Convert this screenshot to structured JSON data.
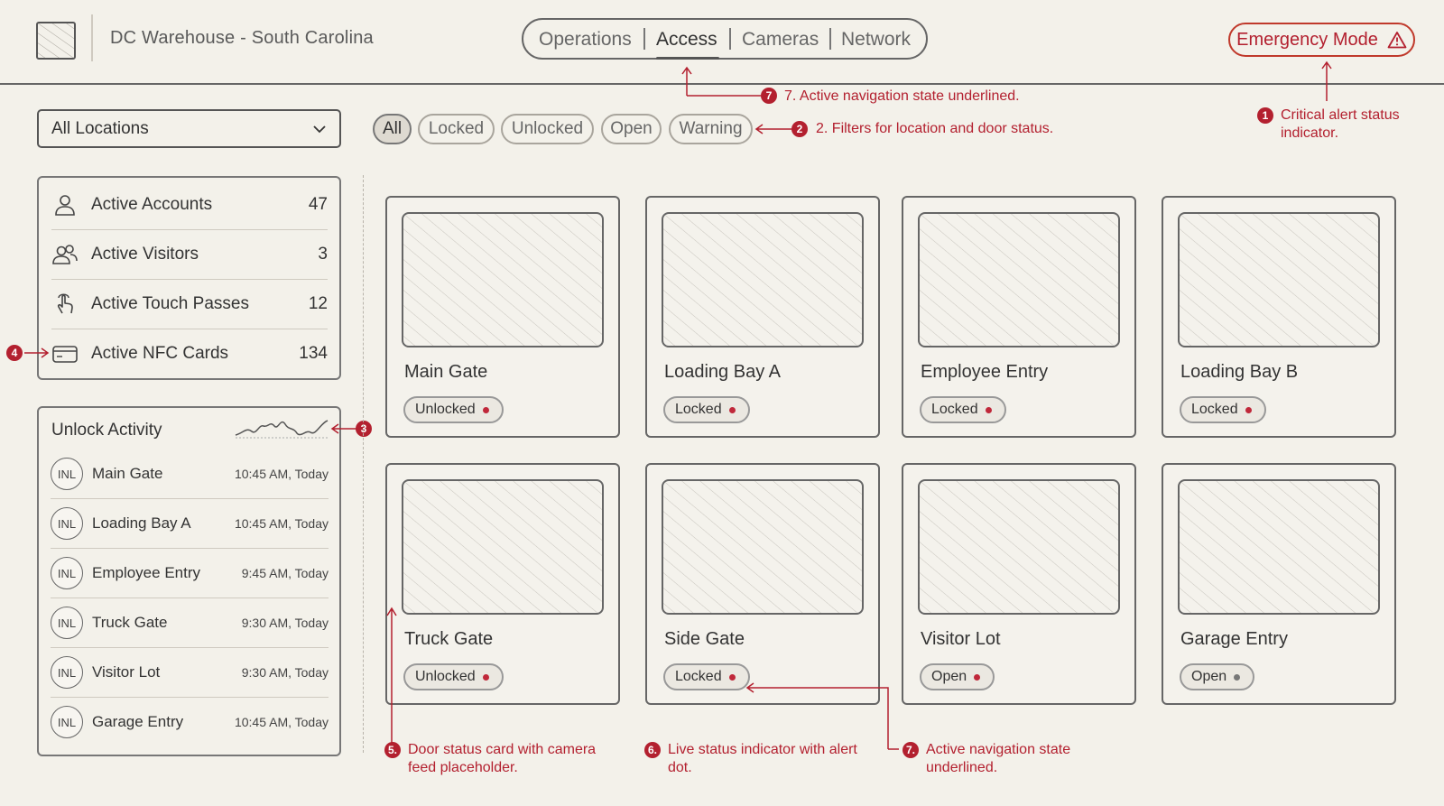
{
  "header": {
    "site_title": "DC Warehouse - South Carolina",
    "nav_tabs": [
      {
        "label": "Operations",
        "active": false
      },
      {
        "label": "Access",
        "active": true
      },
      {
        "label": "Cameras",
        "active": false
      },
      {
        "label": "Network",
        "active": false
      }
    ],
    "emergency_label": "Emergency Mode",
    "emergency_icon": "warning-triangle-icon"
  },
  "location_select": {
    "value": "All Locations"
  },
  "filters": [
    "All",
    "Locked",
    "Unlocked",
    "Open",
    "Warning"
  ],
  "active_filter": "All",
  "stats": [
    {
      "label": "Active Accounts",
      "value": "47",
      "icon": "user-icon"
    },
    {
      "label": "Active Visitors",
      "value": "3",
      "icon": "users-icon"
    },
    {
      "label": "Active Touch Passes",
      "value": "12",
      "icon": "touch-icon"
    },
    {
      "label": "Active NFC Cards",
      "value": "134",
      "icon": "card-icon"
    }
  ],
  "activity": {
    "title": "Unlock Activity",
    "items": [
      {
        "initials": "INL",
        "label": "Main Gate",
        "time": "10:45 AM, Today"
      },
      {
        "initials": "INL",
        "label": "Loading Bay A",
        "time": "10:45 AM, Today"
      },
      {
        "initials": "INL",
        "label": "Employee Entry",
        "time": "9:45 AM, Today"
      },
      {
        "initials": "INL",
        "label": "Truck Gate",
        "time": "9:30 AM, Today"
      },
      {
        "initials": "INL",
        "label": "Visitor Lot",
        "time": "9:30 AM, Today"
      },
      {
        "initials": "INL",
        "label": "Garage Entry",
        "time": "10:45 AM, Today"
      }
    ]
  },
  "doors": [
    {
      "name": "Main Gate",
      "status": "Unlocked"
    },
    {
      "name": "Loading Bay A",
      "status": "Locked"
    },
    {
      "name": "Employee Entry",
      "status": "Locked"
    },
    {
      "name": "Loading Bay B",
      "status": "Locked"
    },
    {
      "name": "Truck Gate",
      "status": "Unlocked"
    },
    {
      "name": "Side Gate",
      "status": "Locked"
    },
    {
      "name": "Visitor Lot",
      "status": "Open"
    },
    {
      "name": "Garage Entry",
      "status": "Open"
    }
  ],
  "annotations": {
    "a1_num": "1",
    "a1_text": "Critical alert status indicator.",
    "a2_num": "2",
    "a2_text": "2. Filters for location and door status.",
    "a3_num": "3",
    "a4_num": "4",
    "a5_num": "5.",
    "a5_text": "Door status card with camera feed placeholder.",
    "a6_num": "6.",
    "a6_text": "Live status indicator with alert dot.",
    "a7_num": "7",
    "a7_text": "7. Active navigation state underlined.",
    "a7b_num": "7.",
    "a7b_text": "Active navigation state underlined."
  },
  "colors": {
    "accent_red": "#b3202f",
    "alert_dot": "#c0283a",
    "neutral_dot": "#777777",
    "background": "#f3f1ea"
  }
}
